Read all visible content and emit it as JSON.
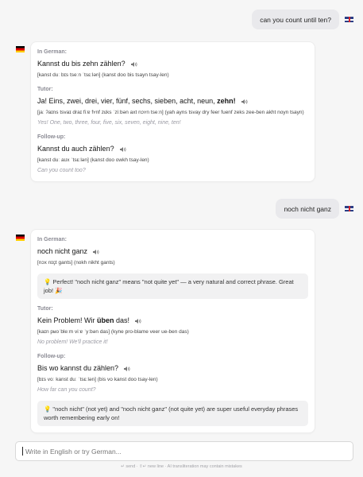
{
  "conversation": {
    "user_msg_1": "can you count until ten?",
    "user_msg_2": "noch nicht ganz",
    "bot_1": {
      "in_german_label": "In German:",
      "phrase": "Kannst du bis zehn zählen?",
      "translit": "[kanst duː bɪs tseːn ˈtsɛːlən] (kanst doo bis tsayn tsay-len)",
      "tutor_label": "Tutor:",
      "tutor_text_plain": "Ja! Eins, zwei, drei, vier, fünf, sechs, sieben, acht, neun, ",
      "tutor_text_bold": "zehn!",
      "tutor_translit": "[jaː ʔaɪns tsvaɪ draɪ fiːɐ fʏnf zɛks ˈziːbən axt nɔʏn tseːn] (yah ayns tsvay dry feer fuenf zeks zee-ben akht noyn tsayn)",
      "tutor_translation": "Yes! One, two, three, four, five, six, seven, eight, nine, ten!",
      "followup_label": "Follow-up:",
      "followup_phrase": "Kannst du auch zählen?",
      "followup_translit": "[kanst duː aʊx ˈtsɛːlən] (kanst doo owkh tsay-len)",
      "followup_translation": "Can you count too?"
    },
    "bot_2": {
      "in_german_label": "In German:",
      "phrase": "noch nicht ganz",
      "translit": "[nɔx nɪçt gants] (nokh nikht gants)",
      "note": "💡 Perfect! \"noch nicht ganz\" means \"not quite yet\" — a very natural and correct phrase. Great job! 🎉",
      "tutor_label": "Tutor:",
      "tutor_text_plain": "Kein Problem! Wir ",
      "tutor_text_bold": "üben",
      "tutor_text_end": " das!",
      "tutor_translit": "[kaɪn pʁoˈbleːm viːɐ ˈyːbən das] (kyne pro-blame veer ue-ben das)",
      "tutor_translation": "No problem! We'll practice it!",
      "followup_label": "Follow-up:",
      "followup_phrase": "Bis wo kannst du zählen?",
      "followup_translit": "[bɪs voː kanst duː ˈtsɛːlən] (bis vo kanst doo tsay-len)",
      "followup_translation": "How far can you count?",
      "tip": "💡 \"noch nicht\" (not yet) and \"noch nicht ganz\" (not quite yet) are super useful everyday phrases worth remembering early on!"
    }
  },
  "composer": {
    "placeholder": "Write in English or try German...",
    "footer_hint": "↵ send · ⇧↵ new line · AI transliteration may contain mistakes"
  },
  "icons": {
    "user_flag": "uk-flag-icon",
    "bot_flag": "germany-flag-icon",
    "speaker": "speaker-icon"
  }
}
